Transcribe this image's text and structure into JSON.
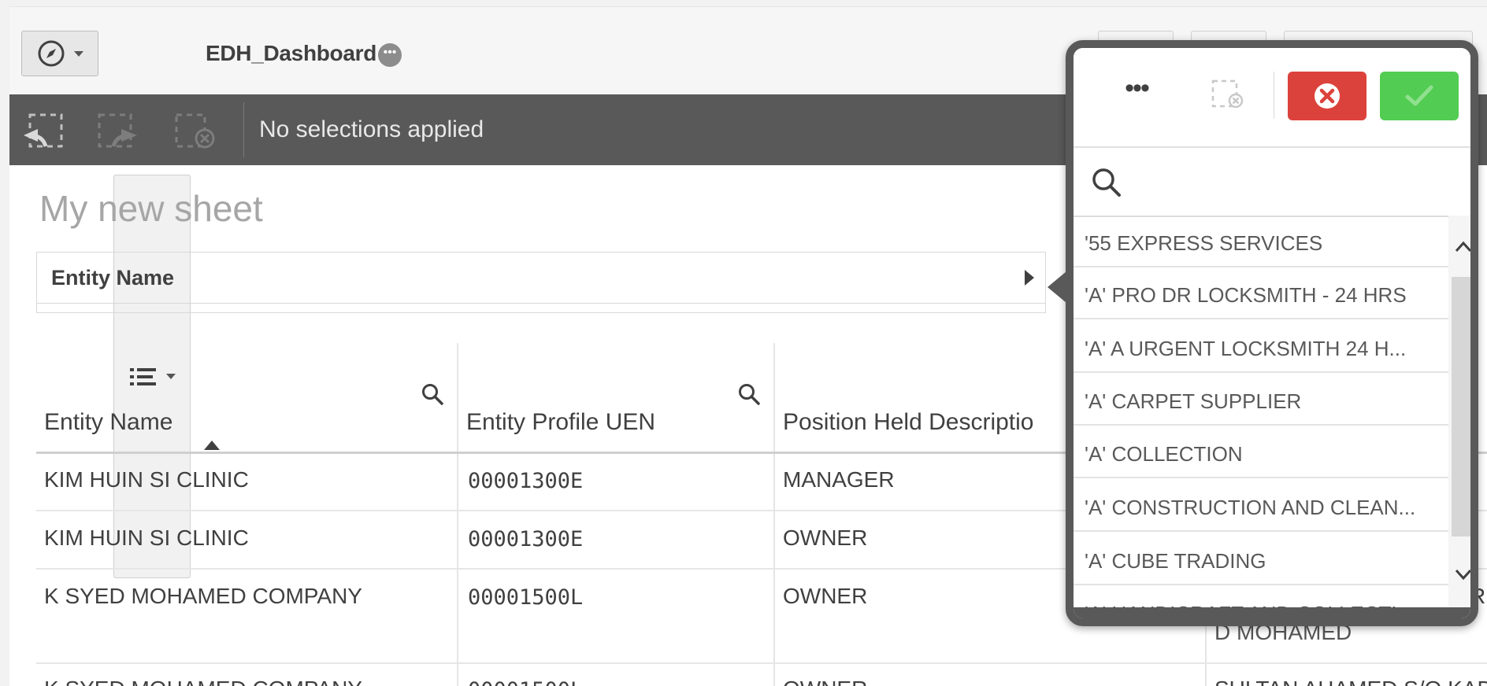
{
  "toolbar": {
    "app_title": "EDH_Dashboard",
    "title_menu_glyph": "•••"
  },
  "selections": {
    "status_text": "No selections applied"
  },
  "sheet": {
    "title": "My new sheet",
    "filter_pane_label": "Entity Name"
  },
  "table": {
    "columns": [
      {
        "label": "Entity Name",
        "searchable": true,
        "sorted": "ascending"
      },
      {
        "label": "Entity Profile UEN",
        "searchable": true
      },
      {
        "label": "Position Held Descriptio",
        "searchable": false
      }
    ],
    "rows": [
      {
        "entity_name": "KIM HUIN SI CLINIC",
        "uen": "00001300E",
        "position": "MANAGER",
        "extra": ""
      },
      {
        "entity_name": "KIM HUIN SI CLINIC",
        "uen": "00001300E",
        "position": "OWNER",
        "extra": ""
      },
      {
        "entity_name": "K SYED MOHAMED COMPANY",
        "uen": "00001500L",
        "position": "OWNER",
        "extra": "RE",
        "extra_line2": "D MOHAMED"
      },
      {
        "entity_name": "K SYED MOHAMED COMPANY",
        "uen": "00001500L",
        "position": "OWNER",
        "extra": "SULTAN AHAMED S/O KADE"
      }
    ]
  },
  "listbox": {
    "more_label": "•••",
    "items": [
      "'55 EXPRESS SERVICES",
      "'A' PRO DR LOCKSMITH - 24 HRS",
      "'A' A URGENT LOCKSMITH 24 H...",
      "'A' CARPET SUPPLIER",
      "'A' COLLECTION",
      "'A' CONSTRUCTION AND CLEAN...",
      "'A' CUBE TRADING",
      "'A' HANDICRAFT AND COLLECTI..."
    ]
  },
  "icons": {
    "navigation": "compass-icon",
    "sheet_list": "list-icon",
    "back": "selection-back-icon",
    "forward": "selection-forward-icon",
    "clear_all": "clear-selections-icon",
    "search": "search-icon",
    "cancel": "close-icon",
    "confirm": "checkmark-icon"
  },
  "colors": {
    "selection_bar": "#595959",
    "cancel": "#dc423c",
    "confirm": "#52cc52"
  }
}
